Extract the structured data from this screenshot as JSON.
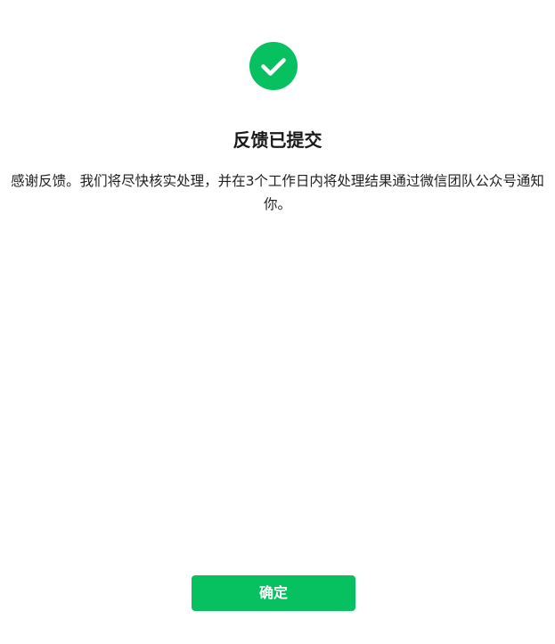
{
  "success": {
    "icon": "check-circle-icon",
    "color": "#07c160"
  },
  "title": "反馈已提交",
  "message": "感谢反馈。我们将尽快核实处理，并在3个工作日内将处理结果通过微信团队公众号通知你。",
  "actions": {
    "confirm_label": "确定",
    "confirm_color": "#07c160"
  }
}
